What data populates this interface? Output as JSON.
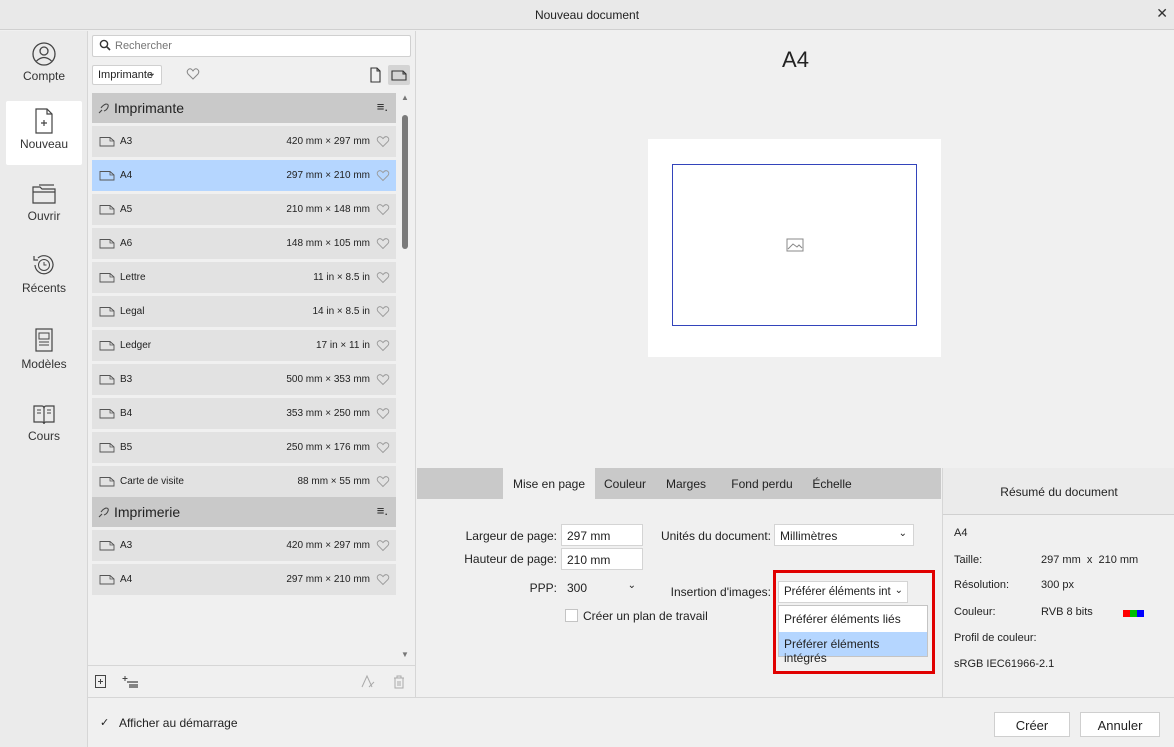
{
  "window": {
    "title": "Nouveau document",
    "close_glyph": "✕"
  },
  "nav": [
    {
      "label": "Compte",
      "icon": "account-icon"
    },
    {
      "label": "Nouveau",
      "icon": "new-document-icon"
    },
    {
      "label": "Ouvrir",
      "icon": "folder-open-icon"
    },
    {
      "label": "Récents",
      "icon": "history-icon"
    },
    {
      "label": "Modèles",
      "icon": "templates-icon"
    },
    {
      "label": "Cours",
      "icon": "book-icon"
    }
  ],
  "list": {
    "search_placeholder": "Rechercher",
    "category": "Imprimante",
    "groups": [
      {
        "name": "Imprimante",
        "items": [
          {
            "name": "A3",
            "size": "420 mm × 297 mm"
          },
          {
            "name": "A4",
            "size": "297 mm × 210 mm"
          },
          {
            "name": "A5",
            "size": "210 mm × 148 mm"
          },
          {
            "name": "A6",
            "size": "148 mm × 105 mm"
          },
          {
            "name": "Lettre",
            "size": "11 in × 8.5 in"
          },
          {
            "name": "Legal",
            "size": "14 in × 8.5 in"
          },
          {
            "name": "Ledger",
            "size": "17 in × 11 in"
          },
          {
            "name": "B3",
            "size": "500 mm × 353 mm"
          },
          {
            "name": "B4",
            "size": "353 mm × 250 mm"
          },
          {
            "name": "B5",
            "size": "250 mm × 176 mm"
          },
          {
            "name": "Carte de visite",
            "size": "88 mm × 55 mm"
          }
        ]
      },
      {
        "name": "Imprimerie",
        "items": [
          {
            "name": "A3",
            "size": "420 mm × 297 mm"
          },
          {
            "name": "A4",
            "size": "297 mm × 210 mm"
          }
        ]
      }
    ],
    "selected": "Imprimante/A4"
  },
  "preview": {
    "format_name": "A4"
  },
  "tabs": [
    "Mise en page",
    "Couleur",
    "Marges",
    "Fond perdu",
    "Échelle"
  ],
  "active_tab": "Mise en page",
  "settings": {
    "width_label": "Largeur de page:",
    "width_value": "297 mm",
    "height_label": "Hauteur de page:",
    "height_value": "210 mm",
    "dpi_label": "PPP:",
    "dpi_value": "300",
    "units_label": "Unités du document:",
    "units_value": "Millimètres",
    "insert_label": "Insertion d'images:",
    "insert_value": "Préférer éléments int",
    "insert_options": [
      "Préférer éléments liés",
      "Préférer éléments intégrés"
    ],
    "insert_highlighted": "Préférer éléments intégrés",
    "artboard_label": "Créer un plan de travail",
    "artboard_checked": false
  },
  "summary": {
    "title": "Résumé du document",
    "name": "A4",
    "size_label": "Taille:",
    "size_value": "297 mm  x  210 mm",
    "res_label": "Résolution:",
    "res_value": "300 px",
    "color_label": "Couleur:",
    "color_value": "RVB 8 bits",
    "swatches": [
      "#ff0000",
      "#00c000",
      "#0000ff"
    ],
    "profile_label": "Profil de couleur:",
    "profile_value": "sRGB IEC61966-2.1"
  },
  "footer": {
    "show_on_start_label": "Afficher au démarrage",
    "show_on_start_checked": true,
    "create_label": "Créer",
    "cancel_label": "Annuler"
  },
  "colors": {
    "accent_selection": "#b5d6ff",
    "highlight_border": "#e00000",
    "frame_blue": "#3344bb"
  }
}
